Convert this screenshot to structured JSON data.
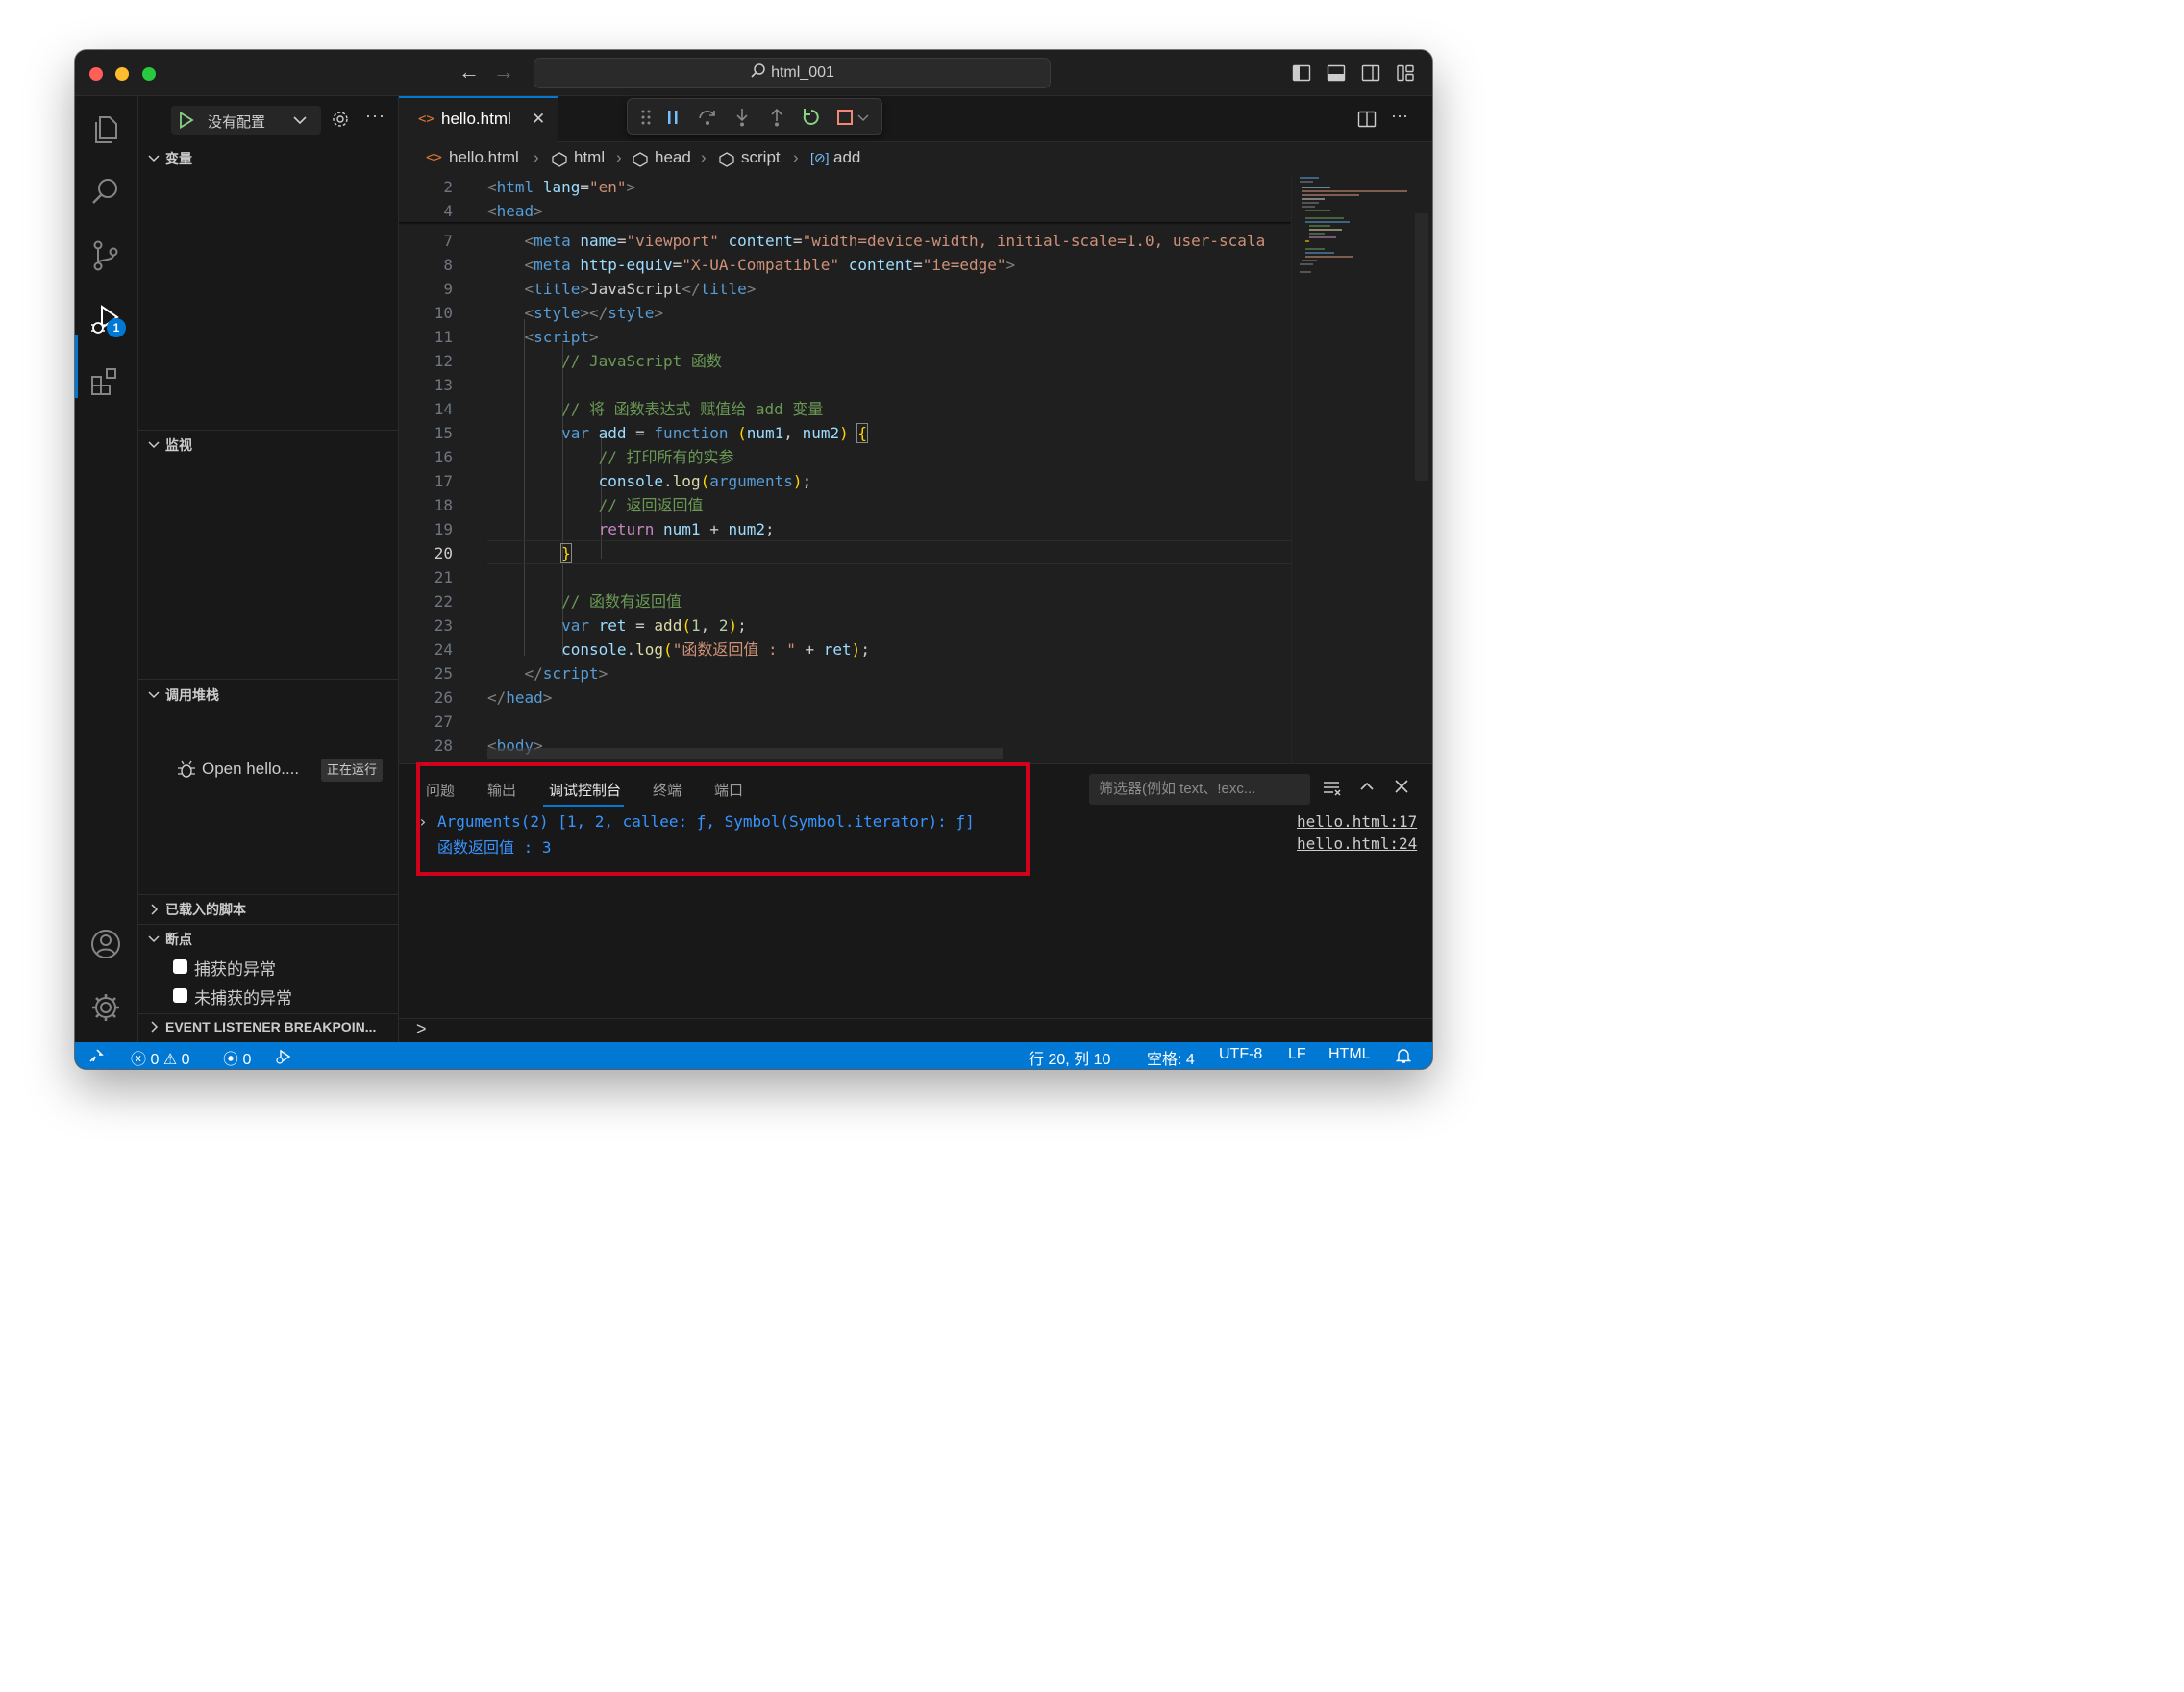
{
  "window": {
    "title": "html_001"
  },
  "sidebar": {
    "run_config": "没有配置",
    "sections": {
      "variables": "变量",
      "watch": "监视",
      "call_stack": "调用堆栈",
      "loaded_scripts": "已载入的脚本",
      "breakpoints": "断点",
      "event_listeners": "EVENT LISTENER BREAKPOIN..."
    },
    "call_stack_item": {
      "label": "Open hello....",
      "status": "正在运行"
    },
    "breakpoints": [
      "捕获的异常",
      "未捕获的异常"
    ]
  },
  "activity": {
    "debug_badge": "1"
  },
  "editor": {
    "tab": "hello.html",
    "breadcrumb": [
      "hello.html",
      "html",
      "head",
      "script",
      "add"
    ],
    "lines": [
      {
        "n": "2",
        "html": "<span class='tg'>&lt;</span><span class='tn'>html</span> <span class='at'>lang</span>=<span class='st'>\"en\"</span><span class='tg'>&gt;</span>"
      },
      {
        "n": "4",
        "html": "<span class='tg'>&lt;</span><span class='tn'>head</span><span class='tg'>&gt;</span>"
      },
      {
        "n": "7",
        "html": "    <span class='tg'>&lt;</span><span class='tn'>meta</span> <span class='at'>name</span>=<span class='st'>\"viewport\"</span> <span class='at'>content</span>=<span class='st'>\"width=device-width, initial-scale=1.0, user-scala</span>"
      },
      {
        "n": "8",
        "html": "    <span class='tg'>&lt;</span><span class='tn'>meta</span> <span class='at'>http-equiv</span>=<span class='st'>\"X-UA-Compatible\"</span> <span class='at'>content</span>=<span class='st'>\"ie=edge\"</span><span class='tg'>&gt;</span>"
      },
      {
        "n": "9",
        "html": "    <span class='tg'>&lt;</span><span class='tn'>title</span><span class='tg'>&gt;</span>JavaScript<span class='tg'>&lt;/</span><span class='tn'>title</span><span class='tg'>&gt;</span>"
      },
      {
        "n": "10",
        "html": "    <span class='tg'>&lt;</span><span class='tn'>style</span><span class='tg'>&gt;&lt;/</span><span class='tn'>style</span><span class='tg'>&gt;</span>"
      },
      {
        "n": "11",
        "html": "    <span class='tg'>&lt;</span><span class='tn'>script</span><span class='tg'>&gt;</span>"
      },
      {
        "n": "12",
        "html": "        <span class='cm'>// JavaScript 函数</span>"
      },
      {
        "n": "13",
        "html": ""
      },
      {
        "n": "14",
        "html": "        <span class='cm'>// 将 函数表达式 赋值给 add 变量</span>"
      },
      {
        "n": "15",
        "html": "        <span class='kw'>var</span> <span class='vr'>add</span> = <span class='kw'>function</span> <span class='br'>(</span><span class='vr'>num1</span>, <span class='vr'>num2</span><span class='br'>)</span> <span class='br br-match'>{</span>"
      },
      {
        "n": "16",
        "html": "            <span class='cm'>// 打印所有的实参</span>"
      },
      {
        "n": "17",
        "html": "            <span class='vr'>console</span>.<span class='fn'>log</span><span class='br'>(</span><span class='vr' style='color:#569cd6'>arguments</span><span class='br'>)</span>;"
      },
      {
        "n": "18",
        "html": "            <span class='cm'>// 返回返回值</span>"
      },
      {
        "n": "19",
        "html": "            <span class='kw' style='color:#c586c0'>return</span> <span class='vr'>num1</span> + <span class='vr'>num2</span>;"
      },
      {
        "n": "20",
        "html": "        <span class='br br-match'>}</span>"
      },
      {
        "n": "21",
        "html": ""
      },
      {
        "n": "22",
        "html": "        <span class='cm'>// 函数有返回值</span>"
      },
      {
        "n": "23",
        "html": "        <span class='kw'>var</span> <span class='vr'>ret</span> = <span class='fn'>add</span><span class='br'>(</span><span class='nm'>1</span>, <span class='nm'>2</span><span class='br'>)</span>;"
      },
      {
        "n": "24",
        "html": "        <span class='vr'>console</span>.<span class='fn'>log</span><span class='br'>(</span><span class='st'>\"函数返回值 : \"</span> + <span class='vr'>ret</span><span class='br'>)</span>;"
      },
      {
        "n": "25",
        "html": "    <span class='tg'>&lt;/</span><span class='tn'>script</span><span class='tg'>&gt;</span>"
      },
      {
        "n": "26",
        "html": "<span class='tg'>&lt;/</span><span class='tn'>head</span><span class='tg'>&gt;</span>"
      },
      {
        "n": "27",
        "html": ""
      },
      {
        "n": "28",
        "html": "<span class='tg'>&lt;</span><span class='tn'>body</span><span class='tg'>&gt;</span>"
      }
    ],
    "current_line": "20"
  },
  "panel": {
    "tabs": [
      "问题",
      "输出",
      "调试控制台",
      "终端",
      "端口"
    ],
    "active_tab": "调试控制台",
    "filter_placeholder": "筛选器(例如 text、!exc...",
    "console": [
      {
        "text": "Arguments(2) [1, 2, callee: ƒ, Symbol(Symbol.iterator): ƒ]",
        "source": "hello.html:17",
        "expandable": true
      },
      {
        "text": "函数返回值 : 3",
        "source": "hello.html:24",
        "expandable": false
      }
    ],
    "prompt": ">"
  },
  "statusbar": {
    "errors": "0",
    "warnings": "0",
    "ports": "0",
    "position": "行 20, 列 10",
    "spaces": "空格: 4",
    "encoding": "UTF-8",
    "eol": "LF",
    "language": "HTML"
  },
  "colors": {
    "accent": "#0078d4",
    "highlight_box": "#d0021b"
  }
}
